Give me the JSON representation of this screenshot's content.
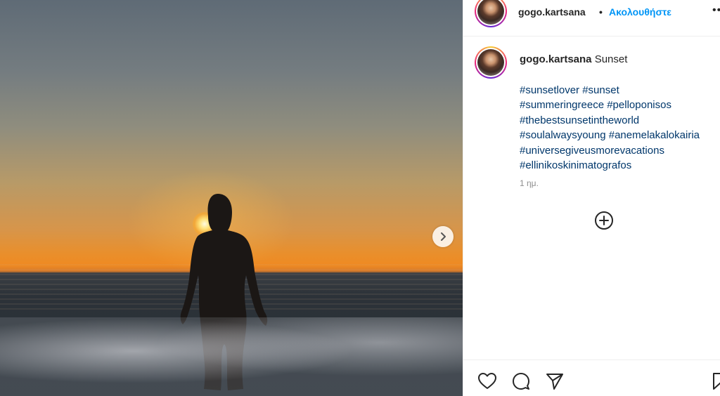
{
  "post": {
    "username": "gogo.kartsana",
    "separator": "•",
    "follow_label": "Ακολουθήστε",
    "more_label": "••",
    "caption_text": "Sunset",
    "hashtag_lines": [
      "#sunsetlover #sunset",
      "#summeringreece #pelloponisos",
      "#thebestsunsetintheworld",
      "#soulalwaysyoung #anemelakalokairia",
      "#universegiveusmorevacations",
      "#ellinikoskinimatografos"
    ],
    "timestamp": "1 ημ."
  },
  "icons": {
    "next": "chevron-right-icon",
    "add_comments": "plus-circle-icon",
    "like": "heart-icon",
    "comment": "comment-bubble-icon",
    "share": "paper-plane-icon",
    "save": "bookmark-icon"
  },
  "colors": {
    "link": "#00376b",
    "follow": "#0095f6",
    "text": "#262626",
    "muted": "#8e8e8e"
  }
}
